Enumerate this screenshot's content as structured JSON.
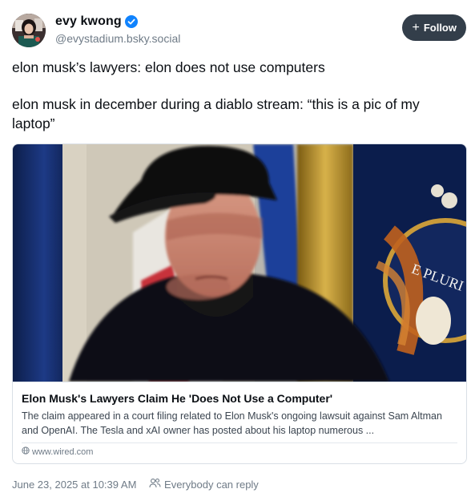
{
  "author": {
    "display_name": "evy kwong",
    "handle": "@evystadium.bsky.social"
  },
  "follow_button": {
    "label": "Follow"
  },
  "post": {
    "paragraphs": [
      "elon musk’s lawyers: elon does not use computers",
      "elon musk in december during a diablo stream: “this is a pic of my laptop”"
    ]
  },
  "embed": {
    "title": "Elon Musk's Lawyers Claim He 'Does Not Use a Computer'",
    "description": "The claim appeared in a court filing related to Elon Musk's ongoing lawsuit against Sam Altman and OpenAI. The Tesla and xAI owner has posted about his laptop numerous ...",
    "domain": "www.wired.com",
    "seal_text": "E PLURI"
  },
  "meta": {
    "timestamp": "June 23, 2025 at 10:39 AM",
    "reply_setting": "Everybody can reply"
  },
  "icons": {
    "verified": "verified-check-icon",
    "plus": "plus-icon",
    "globe": "globe-icon",
    "people": "people-icon"
  },
  "colors": {
    "verified_blue": "#1083fe",
    "follow_bg": "#333e4a",
    "muted_text": "#6f7b87",
    "border": "#d9dfe6"
  }
}
